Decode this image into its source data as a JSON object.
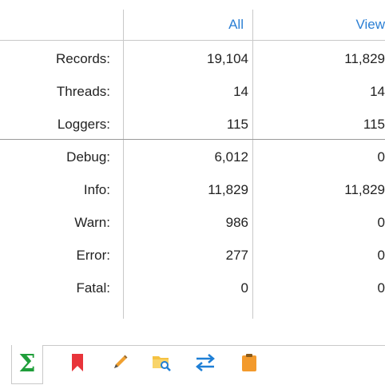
{
  "columns": {
    "all": "All",
    "view": "View"
  },
  "rows": [
    {
      "label": "Records:",
      "all": "19,104",
      "view": "11,829"
    },
    {
      "label": "Threads:",
      "all": "14",
      "view": "14"
    },
    {
      "label": "Loggers:",
      "all": "115",
      "view": "115"
    },
    {
      "label": "Debug:",
      "all": "6,012",
      "view": "0"
    },
    {
      "label": "Info:",
      "all": "11,829",
      "view": "11,829"
    },
    {
      "label": "Warn:",
      "all": "986",
      "view": "0"
    },
    {
      "label": "Error:",
      "all": "277",
      "view": "0"
    },
    {
      "label": "Fatal:",
      "all": "0",
      "view": "0"
    }
  ],
  "toolbar": {
    "tabs": [
      {
        "icon": "sigma-icon",
        "active": true
      },
      {
        "icon": "bookmark-icon",
        "active": false
      },
      {
        "icon": "pencil-icon",
        "active": false
      },
      {
        "icon": "folder-search-icon",
        "active": false
      },
      {
        "icon": "swap-arrows-icon",
        "active": false
      },
      {
        "icon": "clipboard-icon",
        "active": false
      }
    ],
    "sigma_glyph": "Σ"
  },
  "colors": {
    "header_text": "#2b7fd4",
    "sigma": "#1f9e3a",
    "bookmark": "#e8343a",
    "pencil": "#f0a030",
    "folder": "#f5c242",
    "arrows": "#1e7fd6",
    "clipboard": "#f39a2c"
  }
}
